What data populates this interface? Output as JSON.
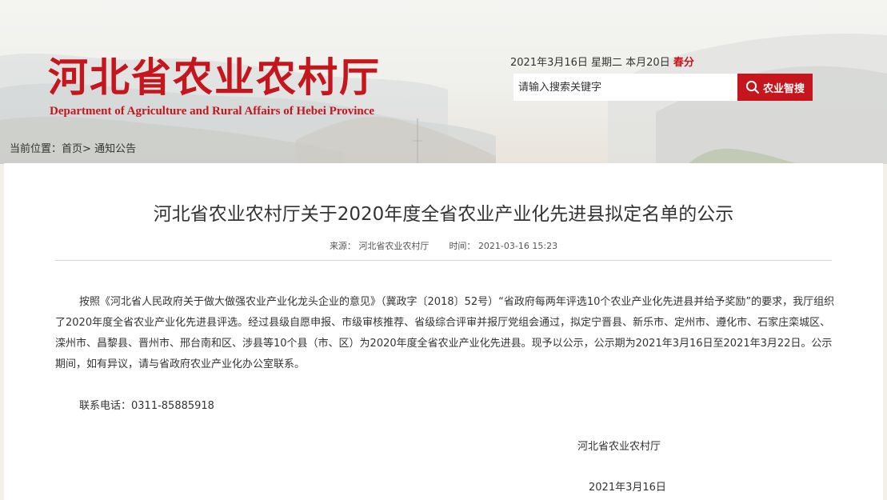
{
  "header": {
    "logo_cn": "河北省农业农村厅",
    "logo_en": "Department of  Agriculture and  Rural Affairs  of Hebei Province",
    "date": "2021年3月16日 星期二 本月20日",
    "solar_term": "春分",
    "search_placeholder": "请输入搜索关键字",
    "search_button": "农业智搜"
  },
  "breadcrumb": {
    "prefix": "当前位置：",
    "home": "首页",
    "separator": ">",
    "current": "通知公告"
  },
  "article": {
    "title": "河北省农业农村厅关于2020年度全省农业产业化先进县拟定名单的公示",
    "source_label": "来源：",
    "source": "河北省农业农村厅",
    "time_label": "时间：",
    "time": "2021-03-16 15:23",
    "body": "按照《河北省人民政府关于做大做强农业产业化龙头企业的意见》（冀政字〔2018〕52号）“省政府每两年评选10个农业产业化先进县并给予奖励”的要求，我厅组织了2020年度全省农业产业化先进县评选。经过县级自愿申报、市级审核推荐、省级综合评审并报厅党组会通过，拟定宁晋县、新乐市、定州市、遵化市、石家庄栾城区、滦州市、昌黎县、晋州市、邢台南和区、涉县等10个县（市、区）为2020年度全省农业产业化先进县。现予以公示，公示期为2021年3月16日至2021年3月22日。公示期间，如有异议，请与省政府农业产业化办公室联系。",
    "contact": "联系电话：0311-85885918",
    "signature_org": "河北省农业农村厅",
    "signature_date": "2021年3月16日"
  },
  "colors": {
    "brand_red": "#c4161c",
    "text": "#333333"
  }
}
